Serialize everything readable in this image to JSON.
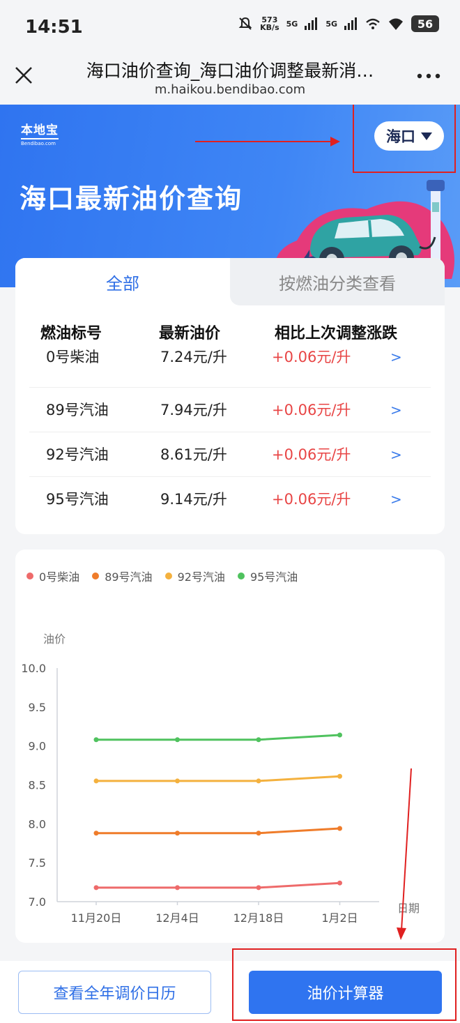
{
  "status_bar": {
    "time": "14:51",
    "net_speed_value": "573",
    "net_speed_unit": "KB/s",
    "sig1": "5G",
    "sig2": "5G",
    "battery": "56"
  },
  "browser": {
    "title": "海口油价查询_海口油价调整最新消…",
    "url": "m.haikou.bendibao.com"
  },
  "hero": {
    "logo_cn": "本地宝",
    "logo_en": "Bendibao.com",
    "city": "海口",
    "title": "海口最新油价查询"
  },
  "tabs": [
    {
      "label": "全部"
    },
    {
      "label": "按燃油分类查看"
    }
  ],
  "table": {
    "headers": [
      "燃油标号",
      "最新油价",
      "相比上次调整涨跌"
    ],
    "rows": [
      {
        "fuel": "0号柴油",
        "price": "7.24元/升",
        "change": "+0.06元/升",
        "arrow": ">"
      },
      {
        "fuel": "89号汽油",
        "price": "7.94元/升",
        "change": "+0.06元/升",
        "arrow": ">"
      },
      {
        "fuel": "92号汽油",
        "price": "8.61元/升",
        "change": "+0.06元/升",
        "arrow": ">"
      },
      {
        "fuel": "95号汽油",
        "price": "9.14元/升",
        "change": "+0.06元/升",
        "arrow": ">"
      }
    ]
  },
  "chart_data": {
    "type": "line",
    "ylabel": "油价",
    "xlabel": "日期",
    "categories": [
      "11月20日",
      "12月4日",
      "12月18日",
      "1月2日"
    ],
    "ylim": [
      7.0,
      10.0
    ],
    "yticks": [
      "7.0",
      "7.5",
      "8.0",
      "8.5",
      "9.0",
      "9.5",
      "10.0"
    ],
    "legend_position": "top-left",
    "series": [
      {
        "name": "0号柴油",
        "color": "#ee6a6a",
        "values": [
          7.18,
          7.18,
          7.18,
          7.24
        ]
      },
      {
        "name": "89号汽油",
        "color": "#ef7c2a",
        "values": [
          7.88,
          7.88,
          7.88,
          7.94
        ]
      },
      {
        "name": "92号汽油",
        "color": "#f4b13e",
        "values": [
          8.55,
          8.55,
          8.55,
          8.61
        ]
      },
      {
        "name": "95号汽油",
        "color": "#4fc25e",
        "values": [
          9.08,
          9.08,
          9.08,
          9.14
        ]
      }
    ]
  },
  "actions": {
    "calendar_label": "查看全年调价日历",
    "calculator_label": "油价计算器"
  },
  "colors": {
    "primary": "#2f74f0",
    "rise": "#e84545",
    "annotation": "#e02020"
  }
}
